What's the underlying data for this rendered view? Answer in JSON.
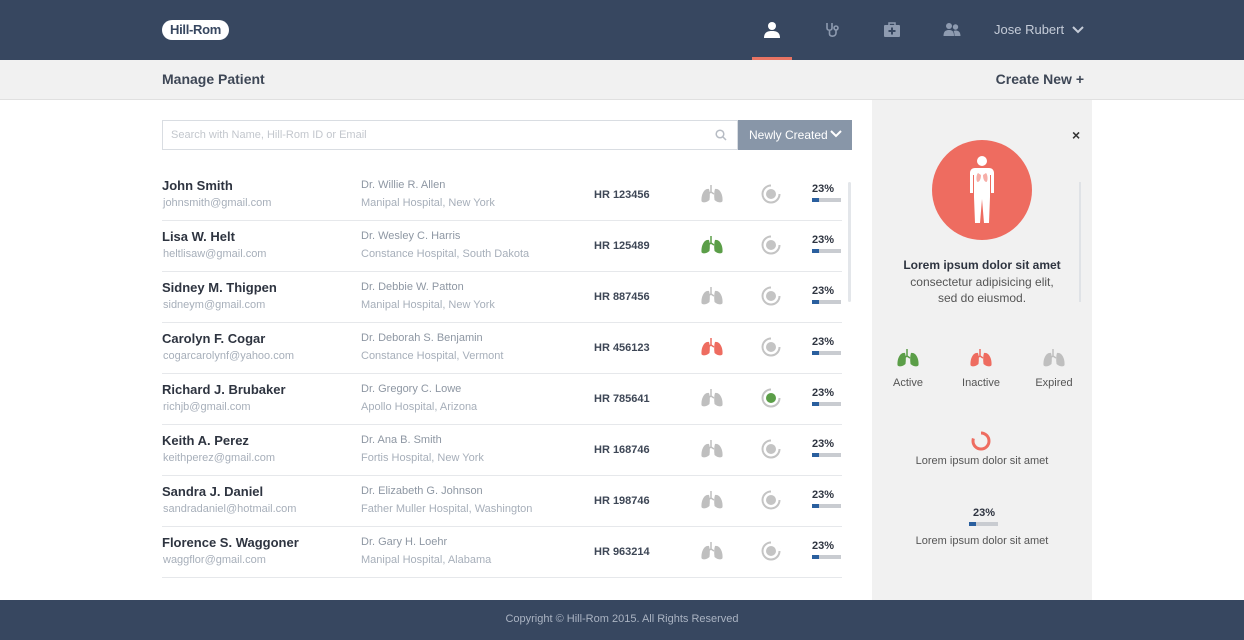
{
  "header": {
    "logo_text": "Hill-Rom",
    "nav": [
      {
        "icon": "patient-icon",
        "active": true
      },
      {
        "icon": "stethoscope-icon",
        "active": false
      },
      {
        "icon": "medical-kit-icon",
        "active": false
      },
      {
        "icon": "users-icon",
        "active": false
      }
    ],
    "user_name": "Jose Rubert"
  },
  "subheader": {
    "title": "Manage Patient",
    "create_new": "Create New +"
  },
  "search": {
    "placeholder": "Search with Name, Hill-Rom ID or Email",
    "sort_label": "Newly Created"
  },
  "colors": {
    "status_active": "#5b9e48",
    "status_inactive": "#ee6c60",
    "status_expired": "#bfbfbf",
    "accent": "#e87463",
    "progress_fill": "#2a5f9e"
  },
  "patients": [
    {
      "name": "John Smith",
      "email": "johnsmith@gmail.com",
      "doctor": "Dr. Willie R. Allen",
      "hospital": "Manipal Hospital, New York",
      "hr_id": "HR 123456",
      "status": "expired",
      "dial_active": false,
      "progress": "23%",
      "progress_value": 0.23
    },
    {
      "name": "Lisa W. Helt",
      "email": "heltlisaw@gmail.com",
      "doctor": "Dr. Wesley C. Harris",
      "hospital": "Constance Hospital, South Dakota",
      "hr_id": "HR 125489",
      "status": "active",
      "dial_active": false,
      "progress": "23%",
      "progress_value": 0.23
    },
    {
      "name": "Sidney M. Thigpen",
      "email": "sidneym@gmail.com",
      "doctor": "Dr. Debbie W. Patton",
      "hospital": "Manipal Hospital, New York",
      "hr_id": "HR 887456",
      "status": "expired",
      "dial_active": false,
      "progress": "23%",
      "progress_value": 0.23
    },
    {
      "name": "Carolyn F. Cogar",
      "email": "cogarcarolynf@yahoo.com",
      "doctor": "Dr. Deborah S. Benjamin",
      "hospital": "Constance Hospital, Vermont",
      "hr_id": "HR 456123",
      "status": "inactive",
      "dial_active": false,
      "progress": "23%",
      "progress_value": 0.23
    },
    {
      "name": "Richard J. Brubaker",
      "email": "richjb@gmail.com",
      "doctor": "Dr. Gregory C. Lowe",
      "hospital": "Apollo Hospital, Arizona",
      "hr_id": "HR 785641",
      "status": "expired",
      "dial_active": true,
      "progress": "23%",
      "progress_value": 0.23
    },
    {
      "name": "Keith A. Perez",
      "email": "keithperez@gmail.com",
      "doctor": "Dr. Ana B. Smith",
      "hospital": "Fortis Hospital, New York",
      "hr_id": "HR 168746",
      "status": "expired",
      "dial_active": false,
      "progress": "23%",
      "progress_value": 0.23
    },
    {
      "name": "Sandra J. Daniel",
      "email": "sandradaniel@hotmail.com",
      "doctor": "Dr. Elizabeth G. Johnson",
      "hospital": "Father Muller Hospital, Washington",
      "hr_id": "HR 198746",
      "status": "expired",
      "dial_active": false,
      "progress": "23%",
      "progress_value": 0.23
    },
    {
      "name": "Florence S. Waggoner",
      "email": "waggflor@gmail.com",
      "doctor": "Dr. Gary H. Loehr",
      "hospital": "Manipal Hospital, Alabama",
      "hr_id": "HR 963214",
      "status": "expired",
      "dial_active": false,
      "progress": "23%",
      "progress_value": 0.23
    }
  ],
  "side": {
    "close": "×",
    "title": "Lorem ipsum dolor sit amet",
    "subtitle_1": "consectetur adipisicing elit,",
    "subtitle_2": "sed do eiusmod.",
    "legend": [
      {
        "label": "Active",
        "status": "active"
      },
      {
        "label": "Inactive",
        "status": "inactive"
      },
      {
        "label": "Expired",
        "status": "expired"
      }
    ],
    "pie_label": "Lorem ipsum dolor sit amet",
    "progress_text": "23%",
    "progress_value": 0.23,
    "progress_label": "Lorem ipsum dolor sit amet"
  },
  "footer": {
    "copyright": "Copyright © Hill-Rom 2015. All Rights Reserved"
  }
}
